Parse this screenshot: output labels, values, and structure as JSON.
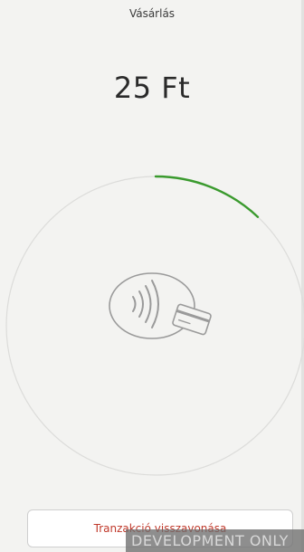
{
  "header": {
    "title": "Vásárlás"
  },
  "payment": {
    "amount": "25 Ft",
    "progress": 0.12,
    "progress_color": "#3a9a2e",
    "icon": "contactless-card-icon"
  },
  "actions": {
    "cancel_label": "Tranzakció visszavonása",
    "cancel_color": "#c0392b"
  },
  "overlay": {
    "dev_banner": "DEVELOPMENT ONLY"
  }
}
